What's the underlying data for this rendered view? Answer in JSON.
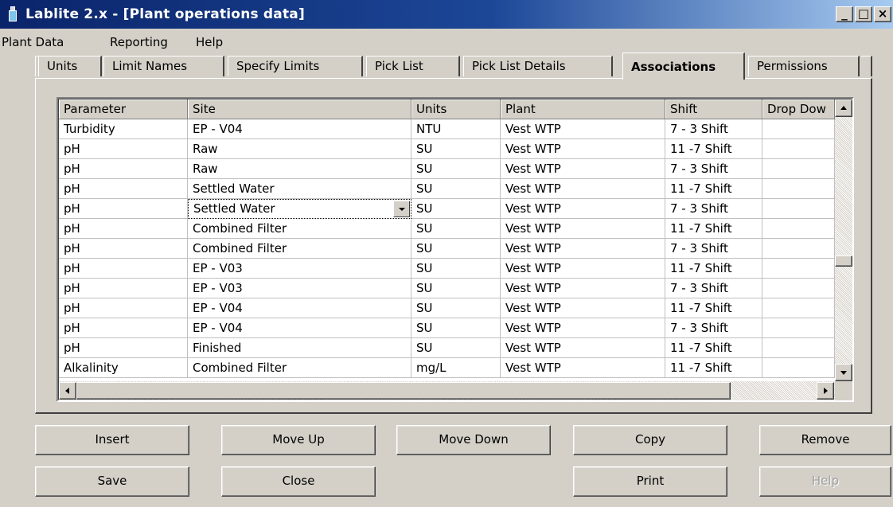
{
  "window": {
    "title": "Lablite 2.x - [Plant operations data]",
    "controls": {
      "minimize": "_",
      "maximize": "□",
      "close": "×"
    }
  },
  "menu": [
    "Plant Data",
    "Reporting",
    "Help"
  ],
  "tabs": [
    {
      "label": "Units",
      "active": false
    },
    {
      "label": "Limit Names",
      "active": false
    },
    {
      "label": "Specify Limits",
      "active": false
    },
    {
      "label": "Pick List",
      "active": false
    },
    {
      "label": "Pick List Details",
      "active": false
    },
    {
      "label": "Associations",
      "active": true
    },
    {
      "label": "Permissions",
      "active": false
    }
  ],
  "grid": {
    "columns": [
      "Parameter",
      "Site",
      "Units",
      "Plant",
      "Shift",
      "Drop Dow"
    ],
    "rows": [
      [
        "Turbidity",
        "EP - V04",
        "NTU",
        "Vest WTP",
        "7 - 3 Shift",
        ""
      ],
      [
        "pH",
        "Raw",
        "SU",
        "Vest WTP",
        "11 -7 Shift",
        ""
      ],
      [
        "pH",
        "Raw",
        "SU",
        "Vest WTP",
        "7 - 3 Shift",
        ""
      ],
      [
        "pH",
        "Settled Water",
        "SU",
        "Vest WTP",
        "11 -7 Shift",
        ""
      ],
      [
        "pH",
        "Settled Water",
        "SU",
        "Vest WTP",
        "7 - 3 Shift",
        ""
      ],
      [
        "pH",
        "Combined Filter",
        "SU",
        "Vest WTP",
        "11 -7 Shift",
        ""
      ],
      [
        "pH",
        "Combined Filter",
        "SU",
        "Vest WTP",
        "7 - 3 Shift",
        ""
      ],
      [
        "pH",
        "EP - V03",
        "SU",
        "Vest WTP",
        "11 -7 Shift",
        ""
      ],
      [
        "pH",
        "EP - V03",
        "SU",
        "Vest WTP",
        "7 - 3 Shift",
        ""
      ],
      [
        "pH",
        "EP - V04",
        "SU",
        "Vest WTP",
        "11 -7 Shift",
        ""
      ],
      [
        "pH",
        "EP - V04",
        "SU",
        "Vest WTP",
        "7 - 3 Shift",
        ""
      ],
      [
        "pH",
        "Finished",
        "SU",
        "Vest WTP",
        "11 -7 Shift",
        ""
      ],
      [
        "Alkalinity",
        "Combined Filter",
        "mg/L",
        "Vest WTP",
        "11 -7 Shift",
        ""
      ]
    ],
    "editing_cell": {
      "row": 4,
      "col": 1
    }
  },
  "buttons": {
    "insert": "Insert",
    "move_up": "Move Up",
    "move_down": "Move Down",
    "copy": "Copy",
    "remove": "Remove",
    "save": "Save",
    "close": "Close",
    "print": "Print",
    "help": "Help"
  },
  "colors": {
    "face": "#d4d0c8",
    "title_start": "#0a246a",
    "title_end": "#a6caf0"
  }
}
